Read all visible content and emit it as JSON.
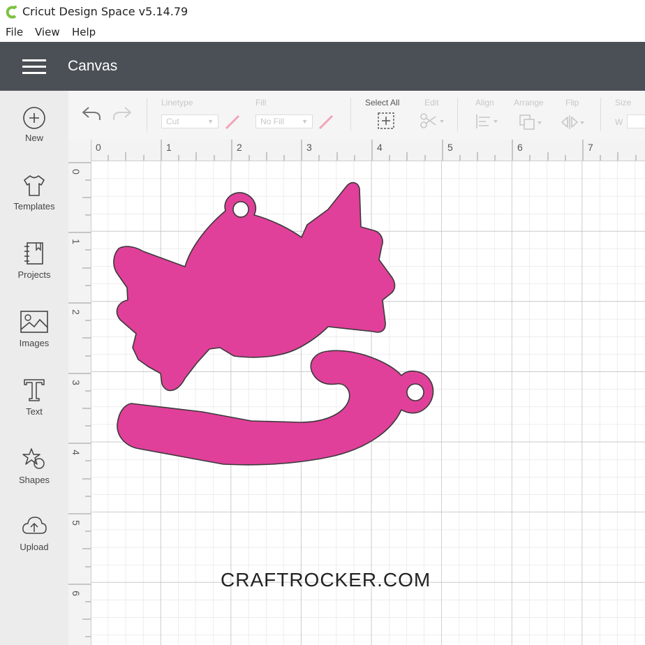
{
  "app": {
    "title": "Cricut Design Space  v5.14.79"
  },
  "menu": {
    "items": [
      "File",
      "View",
      "Help"
    ]
  },
  "header": {
    "title": "Canvas"
  },
  "sidebar": {
    "items": [
      {
        "label": "New",
        "icon": "plus-circle-icon"
      },
      {
        "label": "Templates",
        "icon": "tshirt-icon"
      },
      {
        "label": "Projects",
        "icon": "notebook-icon"
      },
      {
        "label": "Images",
        "icon": "image-icon"
      },
      {
        "label": "Text",
        "icon": "text-t-icon"
      },
      {
        "label": "Shapes",
        "icon": "shapes-icon"
      },
      {
        "label": "Upload",
        "icon": "cloud-upload-icon"
      }
    ]
  },
  "toolbar": {
    "linetype_label": "Linetype",
    "linetype_value": "Cut",
    "fill_label": "Fill",
    "fill_value": "No Fill",
    "select_all_label": "Select All",
    "edit_label": "Edit",
    "align_label": "Align",
    "arrange_label": "Arrange",
    "flip_label": "Flip",
    "size_label": "Size",
    "size_w": "W"
  },
  "rulers": {
    "top": [
      "0",
      "1",
      "2",
      "3",
      "4",
      "5",
      "6",
      "7"
    ],
    "left": [
      "0",
      "1",
      "2",
      "3",
      "4",
      "5",
      "6"
    ]
  },
  "colors": {
    "shape_fill": "#e0409a",
    "header_bg": "#4b5056"
  },
  "watermark": "CRAFTROCKER.COM"
}
